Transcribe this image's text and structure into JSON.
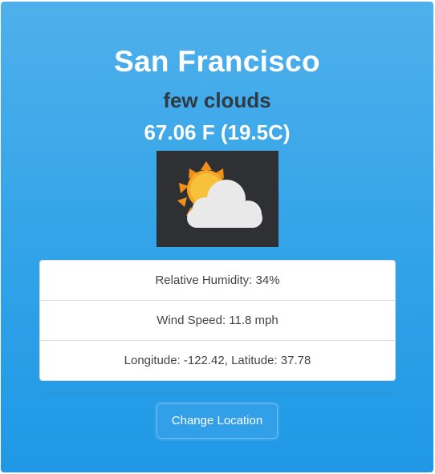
{
  "weather": {
    "city": "San Francisco",
    "condition": "few clouds",
    "temperature": "67.06 F (19.5C)",
    "icon": "partly-cloudy-day-icon"
  },
  "details": [
    {
      "text": "Relative Humidity: 34%"
    },
    {
      "text": "Wind Speed: 11.8 mph"
    },
    {
      "text": "Longitude: -122.42, Latitude: 37.78"
    }
  ],
  "actions": {
    "change_location_label": "Change Location"
  },
  "colors": {
    "card_gradient_top": "#4fb0eb",
    "card_gradient_bottom": "#1f98e6",
    "condition_text": "#2f3a44",
    "icon_background": "#2e3034",
    "sun": "#f5a623",
    "cloud": "#e9e9e9"
  }
}
